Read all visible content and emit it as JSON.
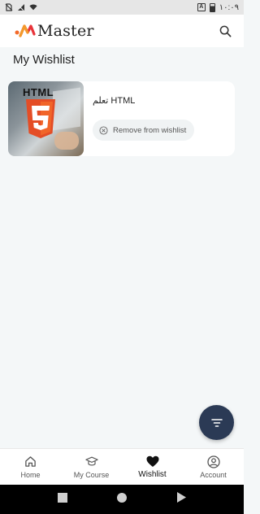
{
  "status_bar": {
    "time": "١٠:٠٩",
    "notification_badge": "A"
  },
  "header": {
    "logo_text": "Master",
    "search_icon": "search-icon"
  },
  "page": {
    "title": "My Wishlist"
  },
  "wishlist": [
    {
      "title": "تعلم HTML",
      "thumbnail_label": "HTML",
      "remove_label": "Remove from wishlist"
    }
  ],
  "fab": {
    "icon": "filter-icon"
  },
  "bottom_nav": {
    "items": [
      {
        "label": "Home",
        "icon": "home-icon"
      },
      {
        "label": "My Course",
        "icon": "graduation-cap-icon"
      },
      {
        "label": "Wishlist",
        "icon": "heart-icon",
        "active": true
      },
      {
        "label": "Account",
        "icon": "account-icon"
      }
    ]
  },
  "colors": {
    "accent": "#2b3a55",
    "logo_orange": "#f36a2b",
    "logo_red": "#e8343a",
    "background": "#f4f7f8"
  }
}
